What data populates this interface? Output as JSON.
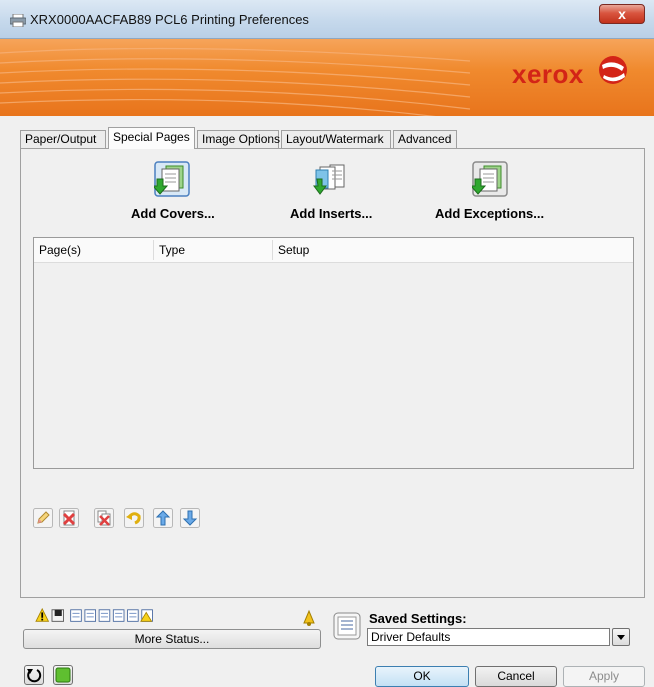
{
  "window": {
    "title": "XRX0000AACFAB89 PCL6 Printing Preferences",
    "close_glyph": "x"
  },
  "banner": {
    "logo_text": "xerox"
  },
  "tabs": [
    {
      "label": "Paper/Output"
    },
    {
      "label": "Special Pages",
      "active": true
    },
    {
      "label": "Image Options"
    },
    {
      "label": "Layout/Watermark"
    },
    {
      "label": "Advanced"
    }
  ],
  "special_pages": {
    "add_covers": "Add Covers...",
    "add_inserts": "Add Inserts...",
    "add_exceptions": "Add Exceptions..."
  },
  "list": {
    "columns": [
      "Page(s)",
      "Type",
      "Setup"
    ],
    "rows": []
  },
  "toolbar": {
    "icons": [
      "edit-icon",
      "delete-icon",
      "delete-all-icon",
      "undo-icon",
      "move-up-icon",
      "move-down-icon"
    ]
  },
  "status": {
    "more_status_label": "More Status..."
  },
  "saved_settings": {
    "label": "Saved Settings:",
    "value": "Driver Defaults"
  },
  "buttons": {
    "ok": "OK",
    "cancel": "Cancel",
    "apply": "Apply"
  },
  "colors": {
    "banner": "#f08a2e",
    "logo": "#d32417",
    "close": "#c2321c"
  }
}
